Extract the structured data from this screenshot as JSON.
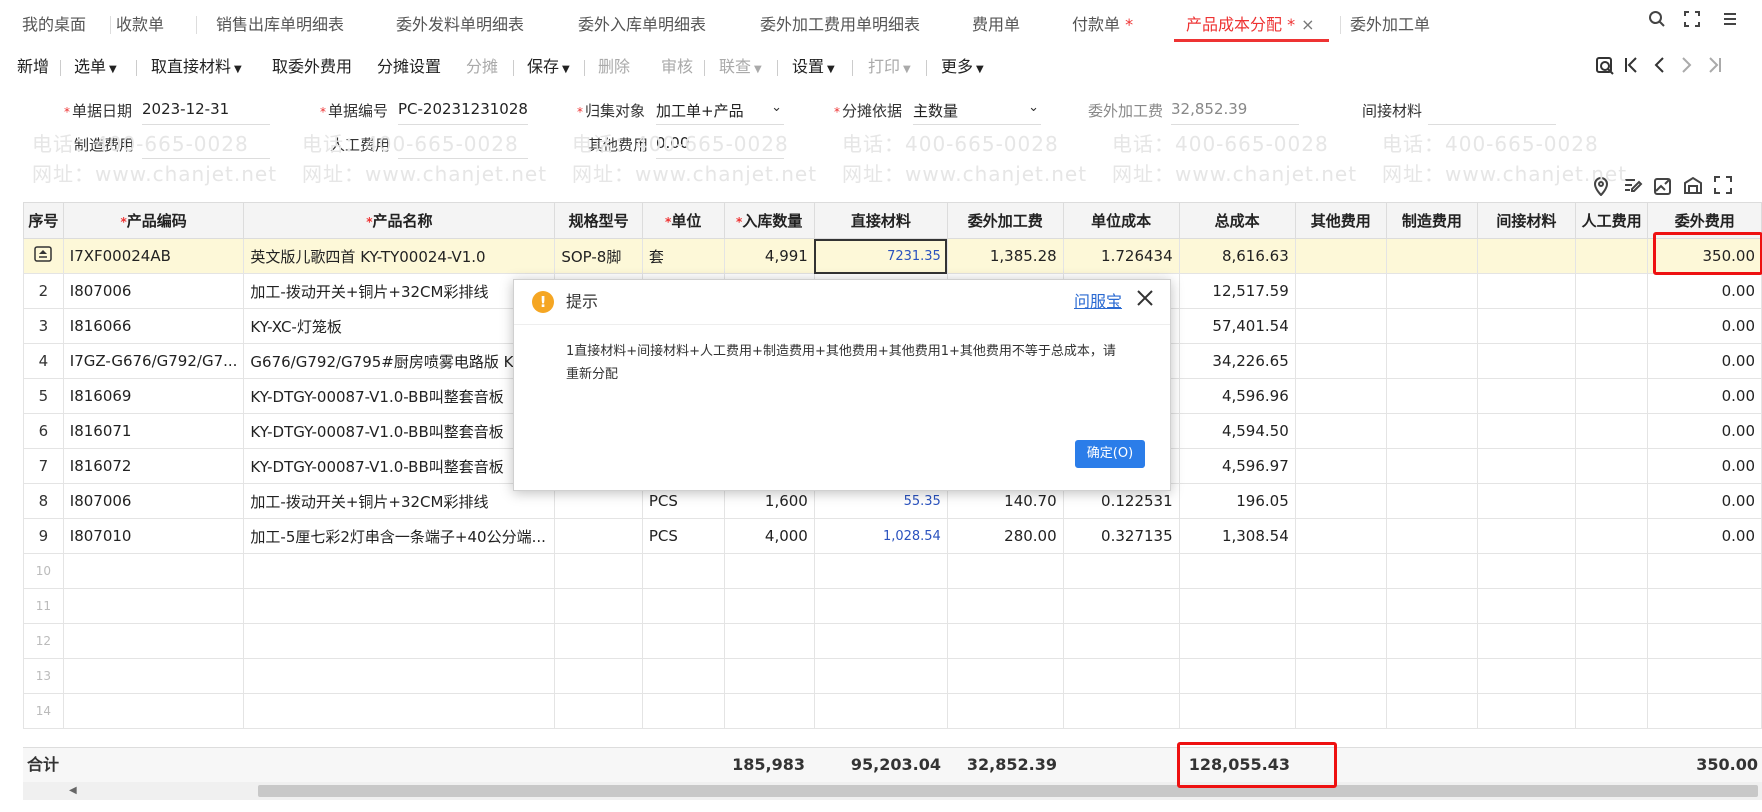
{
  "tabs": [
    {
      "label": "我的桌面",
      "star": ""
    },
    {
      "label": "收款单",
      "star": ""
    },
    {
      "label": "销售出库单明细表",
      "star": ""
    },
    {
      "label": "委外发料单明细表",
      "star": ""
    },
    {
      "label": "委外入库单明细表",
      "star": ""
    },
    {
      "label": "委外加工费用单明细表",
      "star": ""
    },
    {
      "label": "费用单",
      "star": ""
    },
    {
      "label": "付款单",
      "star": " *"
    },
    {
      "label": "产品成本分配",
      "star": " *",
      "close": "×"
    },
    {
      "label": "委外加工单",
      "star": ""
    }
  ],
  "toolbar": {
    "new": "新增",
    "select_doc": "选单",
    "direct_material": "取直接材料",
    "outsourcing_fee": "取委外费用",
    "allocation_settings": "分摊设置",
    "allocate": "分摊",
    "save": "保存",
    "delete": "删除",
    "audit": "审核",
    "link": "联查",
    "settings": "设置",
    "print": "打印",
    "more": "更多"
  },
  "form": {
    "doc_date_label": "单据日期",
    "doc_date": "2023-12-31",
    "doc_no_label": "单据编号",
    "doc_no": "PC-20231231028",
    "collect_target_label": "归集对象",
    "collect_target": "加工单+产品",
    "allocation_basis_label": "分摊依据",
    "allocation_basis": "主数量",
    "outsourcing_fee_label": "委外加工费",
    "outsourcing_fee": "32,852.39",
    "indirect_material_label": "间接材料",
    "indirect_material": "",
    "manufacturing_fee_label": "制造费用",
    "manufacturing_fee": "",
    "labor_fee_label": "人工费用",
    "labor_fee": "",
    "other_fee_label": "其他费用",
    "other_fee": "0.00"
  },
  "watermark": {
    "phone": "电话：400-665-0028",
    "site": "网址：www.chanjet.net"
  },
  "grid": {
    "headers": [
      "序号",
      "产品编码",
      "产品名称",
      "规格型号",
      "单位",
      "入库数量",
      "直接材料",
      "委外加工费",
      "单位成本",
      "总成本",
      "其他费用",
      "制造费用",
      "间接材料",
      "人工费用",
      "委外费用"
    ],
    "rows": [
      {
        "idx": "",
        "code": "I7XF00024AB",
        "name": "英文版儿歌四首  KY-TY00024-V1.0",
        "spec": "SOP-8脚",
        "unit": "套",
        "qty": "4,991",
        "direct": "7231.35",
        "outsrc": "1,385.28",
        "unit_cost": "1.726434",
        "total": "8,616.63",
        "other": "",
        "mfg": "",
        "indirect": "",
        "labor": "",
        "outfee": "350.00"
      },
      {
        "idx": "2",
        "code": "I807006",
        "name": "加工-拨动开关+铜片+32CM彩排线",
        "spec": "",
        "unit": "",
        "qty": "",
        "direct": "",
        "outsrc": "",
        "unit_cost": "",
        "total": "12,517.59",
        "other": "",
        "mfg": "",
        "indirect": "",
        "labor": "",
        "outfee": "0.00"
      },
      {
        "idx": "3",
        "code": "I816066",
        "name": "KY-XC-灯笼板",
        "spec": "",
        "unit": "",
        "qty": "",
        "direct": "",
        "outsrc": "",
        "unit_cost": "",
        "total": "57,401.54",
        "other": "",
        "mfg": "",
        "indirect": "",
        "labor": "",
        "outfee": "0.00"
      },
      {
        "idx": "4",
        "code": "I7GZ-G676/G792/G7...",
        "name": "G676/G792/G795#厨房喷雾电路版 KY00",
        "spec": "",
        "unit": "",
        "qty": "",
        "direct": "",
        "outsrc": "",
        "unit_cost": "",
        "total": "34,226.65",
        "other": "",
        "mfg": "",
        "indirect": "",
        "labor": "",
        "outfee": "0.00"
      },
      {
        "idx": "5",
        "code": "I816069",
        "name": "KY-DTGY-00087-V1.0-BB叫整套音板",
        "spec": "",
        "unit": "",
        "qty": "",
        "direct": "",
        "outsrc": "",
        "unit_cost": "",
        "total": "4,596.96",
        "other": "",
        "mfg": "",
        "indirect": "",
        "labor": "",
        "outfee": "0.00"
      },
      {
        "idx": "6",
        "code": "I816071",
        "name": "KY-DTGY-00087-V1.0-BB叫整套音板",
        "spec": "",
        "unit": "",
        "qty": "",
        "direct": "",
        "outsrc": "",
        "unit_cost": "",
        "total": "4,594.50",
        "other": "",
        "mfg": "",
        "indirect": "",
        "labor": "",
        "outfee": "0.00"
      },
      {
        "idx": "7",
        "code": "I816072",
        "name": "KY-DTGY-00087-V1.0-BB叫整套音板",
        "spec": "",
        "unit": "",
        "qty": "",
        "direct": "",
        "outsrc": "",
        "unit_cost": "",
        "total": "4,596.97",
        "other": "",
        "mfg": "",
        "indirect": "",
        "labor": "",
        "outfee": "0.00"
      },
      {
        "idx": "8",
        "code": "I807006",
        "name": "加工-拨动开关+铜片+32CM彩排线",
        "spec": "",
        "unit": "PCS",
        "qty": "1,600",
        "direct": "55.35",
        "outsrc": "140.70",
        "unit_cost": "0.122531",
        "total": "196.05",
        "other": "",
        "mfg": "",
        "indirect": "",
        "labor": "",
        "outfee": "0.00"
      },
      {
        "idx": "9",
        "code": "I807010",
        "name": "加工-5厘七彩2灯串含一条端子+40公分端...",
        "spec": "",
        "unit": "PCS",
        "qty": "4,000",
        "direct": "1,028.54",
        "outsrc": "280.00",
        "unit_cost": "0.327135",
        "total": "1,308.54",
        "other": "",
        "mfg": "",
        "indirect": "",
        "labor": "",
        "outfee": "0.00"
      }
    ],
    "empty_rows": [
      "10",
      "11",
      "12",
      "13",
      "14"
    ]
  },
  "summary": {
    "label": "合计",
    "qty": "185,983",
    "direct": "95,203.04",
    "outsrc": "32,852.39",
    "total": "128,055.43",
    "outfee": "350.00"
  },
  "dialog": {
    "title": "提示",
    "link": "问服宝",
    "message": "1直接材料+间接材料+人工费用+制造费用+其他费用+其他费用1+其他费用不等于总成本，请重新分配",
    "ok": "确定(O)"
  },
  "colors": {
    "accent": "#e33333",
    "selected_row": "#fdf8d8",
    "primary_button": "#2b7de9",
    "warning": "#f5a623",
    "highlight_box": "#e11111"
  }
}
